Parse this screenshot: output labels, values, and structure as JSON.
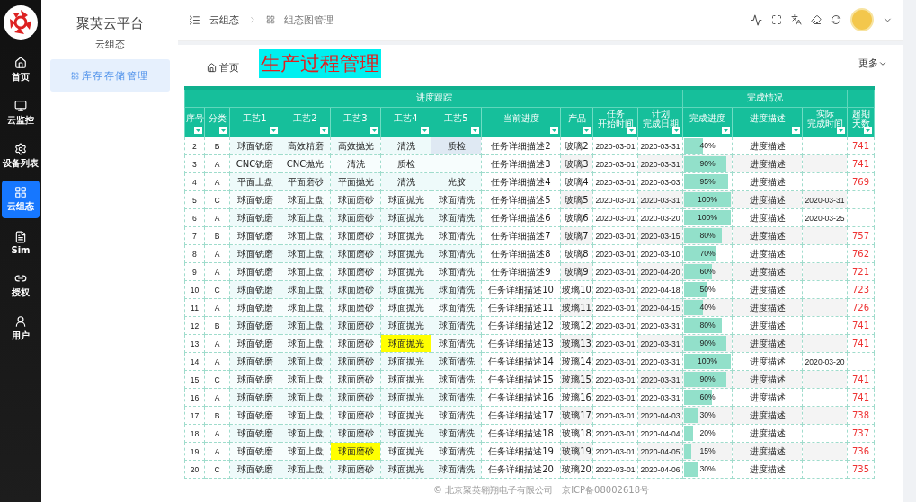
{
  "sidebar": {
    "items": [
      {
        "label": "首页",
        "kind": "home",
        "selected": false
      },
      {
        "label": "云监控",
        "kind": "monitor",
        "selected": false
      },
      {
        "label": "设备列表",
        "kind": "gear",
        "selected": false
      },
      {
        "label": "云组态",
        "kind": "grid",
        "selected": true
      },
      {
        "label": "Sim",
        "kind": "file",
        "selected": false
      },
      {
        "label": "授权",
        "kind": "link",
        "selected": false
      },
      {
        "label": "用户",
        "kind": "user",
        "selected": false
      }
    ]
  },
  "submenu": {
    "title": "聚英云平台",
    "subtitle": "云组态",
    "items": [
      {
        "label": "库存存储管理",
        "selected": true
      }
    ]
  },
  "breadcrumb": [
    "云组态",
    "组态图管理"
  ],
  "tabs": [
    {
      "label": "首页",
      "kind": "home",
      "selected": false
    },
    {
      "label": "生产过程管理",
      "kind": "page",
      "selected": true
    }
  ],
  "more": "更多",
  "table": {
    "groups": [
      {
        "label": "进度跟踪"
      },
      {
        "label": "完成情况"
      }
    ],
    "columns": [
      {
        "lines": [
          "序号"
        ]
      },
      {
        "lines": [
          "分类"
        ]
      },
      {
        "lines": [
          "工艺1"
        ]
      },
      {
        "lines": [
          "工艺2"
        ]
      },
      {
        "lines": [
          "工艺3"
        ]
      },
      {
        "lines": [
          "工艺4"
        ]
      },
      {
        "lines": [
          "工艺5"
        ]
      },
      {
        "lines": [
          "当前进度"
        ]
      },
      {
        "lines": [
          "产品"
        ]
      },
      {
        "lines": [
          "任务",
          "开始时间"
        ]
      },
      {
        "lines": [
          "计划",
          "完成日期"
        ]
      },
      {
        "lines": [
          "完成进度"
        ]
      },
      {
        "lines": [
          "进度描述"
        ]
      },
      {
        "lines": [
          "实际",
          "完成时间"
        ]
      },
      {
        "lines": [
          "超期",
          "天数"
        ]
      }
    ],
    "rows": [
      {
        "n": "2",
        "cls": "B",
        "p": [
          "球面铣磨",
          "高效精磨",
          "高效抛光",
          "清洗",
          {
            "text": "质检",
            "selected": true
          }
        ],
        "task": "任务详细描述2",
        "product": "玻璃2",
        "start": "2020-03-01",
        "plan": "2020-03-31",
        "progress": {
          "level": 0.4,
          "reading": "40%"
        },
        "desc": "进度描述",
        "overdue": "741"
      },
      {
        "n": "3",
        "cls": "A",
        "p": [
          "CNC铣磨",
          "CNC抛光",
          "清洗",
          "质检"
        ],
        "task": "任务详细描述3",
        "product": "玻璃3",
        "start": "2020-03-01",
        "plan": "2020-03-31",
        "progress": {
          "level": 0.9,
          "reading": "90%"
        },
        "desc": "进度描述",
        "overdue": "741"
      },
      {
        "n": "4",
        "cls": "A",
        "p": [
          "平面上盘",
          "平面磨砂",
          "平面抛光",
          "清洗",
          "光胶"
        ],
        "task": "任务详细描述4",
        "product": "玻璃4",
        "start": "2020-03-01",
        "plan": "2020-03-03",
        "progress": {
          "level": 0.95,
          "reading": "95%"
        },
        "desc": "进度描述",
        "overdue": "769"
      },
      {
        "n": "5",
        "cls": "C",
        "p": [
          "球面铣磨",
          "球面上盘",
          "球面磨砂",
          "球面抛光",
          "球面清洗"
        ],
        "task": "任务详细描述5",
        "product": "玻璃5",
        "start": "2020-03-01",
        "plan": "2020-03-31",
        "progress": {
          "level": 1,
          "reading": "100%"
        },
        "desc": "进度描述",
        "actual": "2020-03-31"
      },
      {
        "n": "6",
        "cls": "A",
        "p": [
          "球面铣磨",
          "球面上盘",
          "球面磨砂",
          "球面抛光",
          "球面清洗"
        ],
        "task": "任务详细描述6",
        "product": "玻璃6",
        "start": "2020-03-01",
        "plan": "2020-03-20",
        "progress": {
          "level": 1,
          "reading": "100%"
        },
        "desc": "进度描述",
        "actual": "2020-03-25"
      },
      {
        "n": "7",
        "cls": "B",
        "p": [
          "球面铣磨",
          "球面上盘",
          "球面磨砂",
          "球面抛光",
          "球面清洗"
        ],
        "task": "任务详细描述7",
        "product": "玻璃7",
        "start": "2020-03-01",
        "plan": "2020-03-15",
        "progress": {
          "level": 0.8,
          "reading": "80%"
        },
        "desc": "进度描述",
        "overdue": "757"
      },
      {
        "n": "8",
        "cls": "A",
        "p": [
          "球面铣磨",
          "球面上盘",
          "球面磨砂",
          "球面抛光",
          "球面清洗"
        ],
        "task": "任务详细描述8",
        "product": "玻璃8",
        "start": "2020-03-01",
        "plan": "2020-03-10",
        "progress": {
          "level": 0.7,
          "reading": "70%"
        },
        "desc": "进度描述",
        "overdue": "762"
      },
      {
        "n": "9",
        "cls": "A",
        "p": [
          "球面铣磨",
          "球面上盘",
          "球面磨砂",
          "球面抛光",
          "球面清洗"
        ],
        "task": "任务详细描述9",
        "product": "玻璃9",
        "start": "2020-03-01",
        "plan": "2020-04-20",
        "progress": {
          "level": 0.6,
          "reading": "60%"
        },
        "desc": "进度描述",
        "overdue": "721"
      },
      {
        "n": "10",
        "cls": "C",
        "p": [
          "球面铣磨",
          "球面上盘",
          "球面磨砂",
          "球面抛光",
          "球面清洗"
        ],
        "task": "任务详细描述10",
        "product": "玻璃10",
        "start": "2020-03-01",
        "plan": "2020-04-18",
        "progress": {
          "level": 0.5,
          "reading": "50%"
        },
        "desc": "进度描述",
        "overdue": "723"
      },
      {
        "n": "11",
        "cls": "A",
        "p": [
          "球面铣磨",
          "球面上盘",
          "球面磨砂",
          "球面抛光",
          "球面清洗"
        ],
        "task": "任务详细描述11",
        "product": "玻璃11",
        "start": "2020-03-01",
        "plan": "2020-04-15",
        "progress": {
          "level": 0.4,
          "reading": "40%"
        },
        "desc": "进度描述",
        "overdue": "726"
      },
      {
        "n": "12",
        "cls": "B",
        "p": [
          "球面铣磨",
          "球面上盘",
          "球面磨砂",
          "球面抛光",
          "球面清洗"
        ],
        "task": "任务详细描述12",
        "product": "玻璃12",
        "start": "2020-03-01",
        "plan": "2020-03-31",
        "progress": {
          "level": 0.8,
          "reading": "80%"
        },
        "desc": "进度描述",
        "overdue": "741"
      },
      {
        "n": "13",
        "cls": "A",
        "p": [
          "球面铣磨",
          "球面上盘",
          "球面磨砂",
          {
            "text": "球面抛光",
            "highlighted": true
          },
          "球面清洗"
        ],
        "task": "任务详细描述13",
        "product": "玻璃13",
        "start": "2020-03-01",
        "plan": "2020-03-31",
        "progress": {
          "level": 0.9,
          "reading": "90%"
        },
        "desc": "进度描述",
        "overdue": "741"
      },
      {
        "n": "14",
        "cls": "A",
        "p": [
          "球面铣磨",
          "球面上盘",
          "球面磨砂",
          "球面抛光",
          "球面清洗"
        ],
        "task": "任务详细描述14",
        "product": "玻璃14",
        "start": "2020-03-01",
        "plan": "2020-03-31",
        "progress": {
          "level": 1,
          "reading": "100%"
        },
        "desc": "进度描述",
        "actual": "2020-03-20"
      },
      {
        "n": "15",
        "cls": "C",
        "p": [
          "球面铣磨",
          "球面上盘",
          "球面磨砂",
          "球面抛光",
          "球面清洗"
        ],
        "task": "任务详细描述15",
        "product": "玻璃15",
        "start": "2020-03-01",
        "plan": "2020-03-31",
        "progress": {
          "level": 0.9,
          "reading": "90%"
        },
        "desc": "进度描述",
        "overdue": "741"
      },
      {
        "n": "16",
        "cls": "A",
        "p": [
          "球面铣磨",
          "球面上盘",
          "球面磨砂",
          "球面抛光",
          "球面清洗"
        ],
        "task": "任务详细描述16",
        "product": "玻璃16",
        "start": "2020-03-01",
        "plan": "2020-03-31",
        "progress": {
          "level": 0.6,
          "reading": "60%"
        },
        "desc": "进度描述",
        "overdue": "741"
      },
      {
        "n": "17",
        "cls": "B",
        "p": [
          "球面铣磨",
          "球面上盘",
          "球面磨砂",
          "球面抛光",
          "球面清洗"
        ],
        "task": "任务详细描述17",
        "product": "玻璃17",
        "start": "2020-03-01",
        "plan": "2020-04-03",
        "progress": {
          "level": 0.3,
          "reading": "30%"
        },
        "desc": "进度描述",
        "overdue": "738"
      },
      {
        "n": "18",
        "cls": "A",
        "p": [
          "球面铣磨",
          "球面上盘",
          "球面磨砂",
          "球面抛光",
          "球面清洗"
        ],
        "task": "任务详细描述18",
        "product": "玻璃18",
        "start": "2020-03-01",
        "plan": "2020-04-04",
        "progress": {
          "level": 0.2,
          "reading": "20%"
        },
        "desc": "进度描述",
        "overdue": "737"
      },
      {
        "n": "19",
        "cls": "A",
        "p": [
          "球面铣磨",
          "球面上盘",
          {
            "text": "球面磨砂",
            "highlighted": true
          },
          "球面抛光",
          "球面清洗"
        ],
        "task": "任务详细描述19",
        "product": "玻璃19",
        "start": "2020-03-01",
        "plan": "2020-04-05",
        "progress": {
          "level": 0.15,
          "reading": "15%"
        },
        "desc": "进度描述",
        "overdue": "736"
      },
      {
        "n": "20",
        "cls": "C",
        "p": [
          "球面铣磨",
          "球面上盘",
          "球面磨砂",
          "球面抛光",
          "球面清洗"
        ],
        "task": "任务详细描述20",
        "product": "玻璃20",
        "start": "2020-03-01",
        "plan": "2020-04-06",
        "progress": {
          "level": 0.3,
          "reading": "30%"
        },
        "desc": "进度描述",
        "overdue": "735"
      }
    ]
  },
  "footer": {
    "copyright": "© 北京聚英翱翔电子有限公司",
    "icp": "京ICP备08002618号"
  }
}
